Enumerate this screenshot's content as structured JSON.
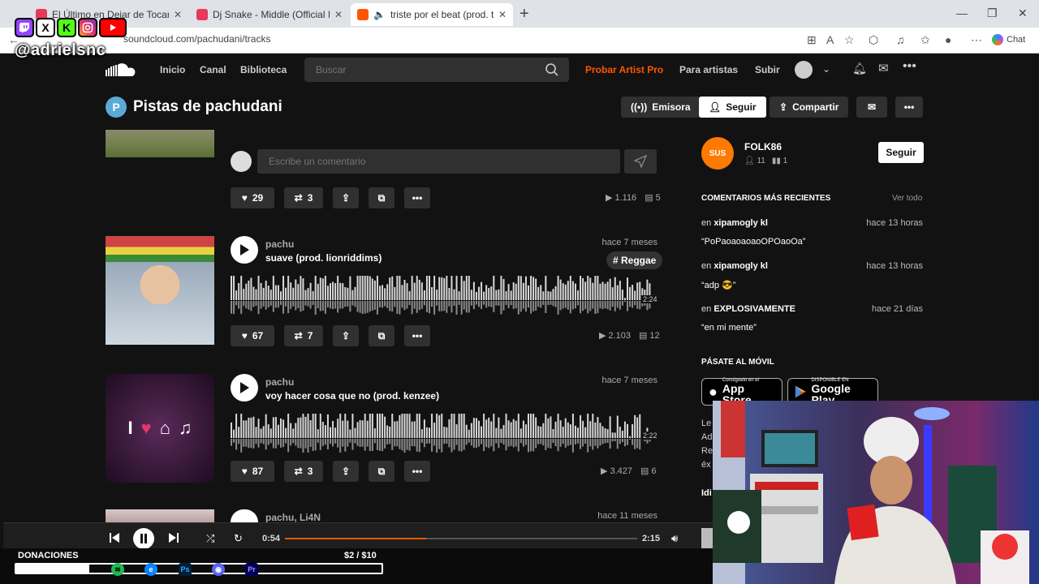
{
  "browser": {
    "tabs": [
      {
        "title": "El Último en Dejar de Tocar La TV",
        "color": "#e6395b"
      },
      {
        "title": "Dj Snake - Middle (Official Instrum",
        "color": "#e6395b"
      },
      {
        "title": "triste por el beat (prod. typhe",
        "color": "#ff5500"
      }
    ],
    "url": "soundcloud.com/pachudani/tracks",
    "chat_label": "Chat"
  },
  "overlay": {
    "handle": "@adrielsnc",
    "social": [
      {
        "label": "T",
        "bg": "#9146ff",
        "fg": "#fff"
      },
      {
        "label": "X",
        "bg": "#fff",
        "fg": "#000"
      },
      {
        "label": "K",
        "bg": "#53fc18",
        "fg": "#000"
      },
      {
        "label": "◎",
        "bg": "#e1306c",
        "fg": "#fff"
      },
      {
        "label": "▶",
        "bg": "#ff0000",
        "fg": "#fff"
      }
    ],
    "donations": {
      "label": "DONACIONES",
      "amount": "$2 / $10",
      "progress": 0.2
    }
  },
  "nav": {
    "links": [
      "Inicio",
      "Canal",
      "Biblioteca"
    ],
    "search_placeholder": "Buscar",
    "pro": "Probar Artist Pro",
    "artists": "Para artistas",
    "upload": "Subir"
  },
  "header": {
    "badge": "P",
    "title": "Pistas de pachudani",
    "station": "Emisora",
    "follow": "Seguir",
    "share": "Compartir"
  },
  "first_track": {
    "comment_placeholder": "Escribe un comentario",
    "likes": "29",
    "reposts": "3",
    "plays": "1.116",
    "comments": "5"
  },
  "tracks": [
    {
      "artist": "pachu",
      "title": "suave (prod. lionriddims)",
      "date": "hace 7 meses",
      "tag": "# Reggae",
      "duration": "2:24",
      "likes": "67",
      "reposts": "7",
      "plays": "2.103",
      "comments": "12"
    },
    {
      "artist": "pachu",
      "title": "voy hacer cosa que no (prod. kenzee)",
      "date": "hace 7 meses",
      "duration": "2:22",
      "likes": "87",
      "reposts": "3",
      "plays": "3.427",
      "comments": "6"
    },
    {
      "artist": "pachu, Li4N",
      "date": "hace 11 meses"
    }
  ],
  "sidebar": {
    "user": {
      "name": "FOLK86",
      "followers": "11",
      "tracks": "1",
      "follow": "Seguir"
    },
    "comments_title": "COMENTARIOS MÁS RECIENTES",
    "see_all": "Ver todo",
    "comments": [
      {
        "prefix": "en",
        "track": "xipamogly kl",
        "time": "hace 13 horas",
        "text": "“PoPaoaoaoaoOPOaoOa”"
      },
      {
        "prefix": "en",
        "track": "xipamogly kl",
        "time": "hace 13 horas",
        "text": "“adp 😎”"
      },
      {
        "prefix": "en",
        "track": "EXPLOSIVAMENTE",
        "time": "hace 21 días",
        "text": "“en mi mente”"
      }
    ],
    "mobile_title": "PÁSATE AL MÓVIL",
    "appstore_small": "Consíguelo en el",
    "appstore": "App Store",
    "gplay_small": "DISPONIBLE EN",
    "gplay": "Google Play",
    "cut_lines": [
      "Le",
      "Ad",
      "Re",
      "éx",
      "Idi"
    ]
  },
  "player": {
    "current": "0:54",
    "total": "2:15",
    "progress": 0.4
  },
  "colors": {
    "accent": "#ff5500",
    "bg": "#121212",
    "button": "#303030"
  }
}
